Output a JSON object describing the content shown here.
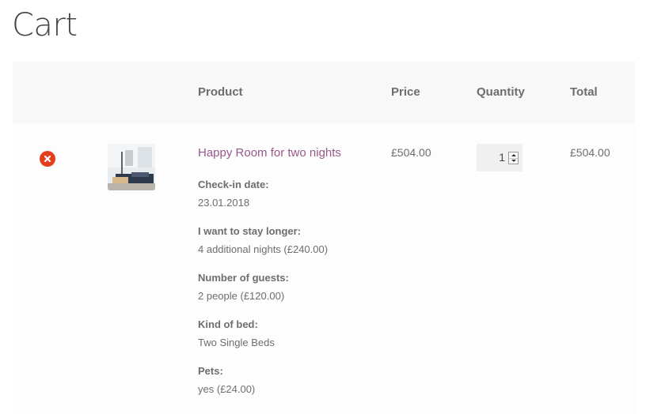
{
  "page": {
    "title": "Cart"
  },
  "table": {
    "headers": {
      "product": "Product",
      "price": "Price",
      "quantity": "Quantity",
      "total": "Total"
    }
  },
  "item": {
    "name": "Happy Room for two nights",
    "price": "£504.00",
    "quantity": "1",
    "total": "£504.00",
    "thumbnail": "room-photo",
    "meta": [
      {
        "label": "Check-in date:",
        "value": "23.01.2018"
      },
      {
        "label": "I want to stay longer:",
        "value": "4 additional nights (£240.00)"
      },
      {
        "label": "Number of guests:",
        "value": "2 people (£120.00)"
      },
      {
        "label": "Kind of bed:",
        "value": "Two Single Beds"
      },
      {
        "label": "Pets:",
        "value": "yes (£24.00)"
      }
    ]
  },
  "colors": {
    "accent": "#96588a",
    "remove": "#e2401c",
    "header_bg": "#f8f8f8",
    "title": "#43454b"
  },
  "icons": {
    "remove": "remove-x-icon"
  }
}
